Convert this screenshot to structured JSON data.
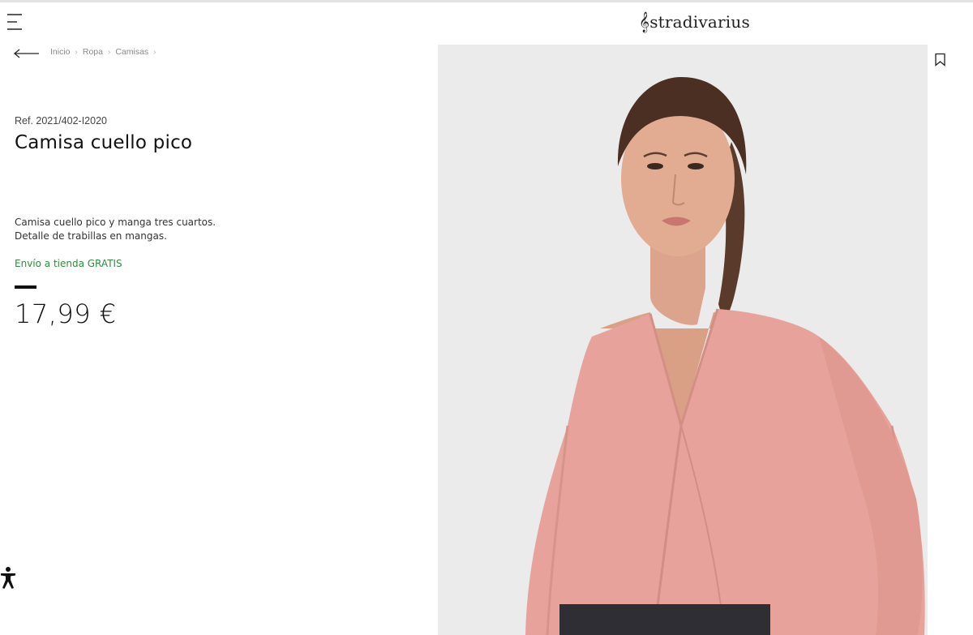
{
  "header": {
    "menu_icon": "hamburger-menu-icon",
    "brand": "stradivarius",
    "brand_mark": "𝄞"
  },
  "breadcrumb": {
    "back_icon": "arrow-left-icon",
    "items": [
      {
        "label": "Inicio"
      },
      {
        "label": "Ropa"
      },
      {
        "label": "Camisas"
      }
    ],
    "separator": "›"
  },
  "product": {
    "ref": "Ref. 2021/402-I2020",
    "title": "Camisa cuello pico",
    "description_line1": "Camisa cuello pico y manga tres cuartos.",
    "description_line2": "Detalle de trabillas en mangas.",
    "shipping": "Envío a tienda GRATIS",
    "price": "17,99 €"
  },
  "colors": {
    "shipping_green": "#2e8b3d",
    "image_background": "#ebebeb",
    "blouse_pink": "#e7a39b"
  },
  "icons": {
    "bookmark": "bookmark-icon",
    "accessibility": "accessibility-icon"
  }
}
